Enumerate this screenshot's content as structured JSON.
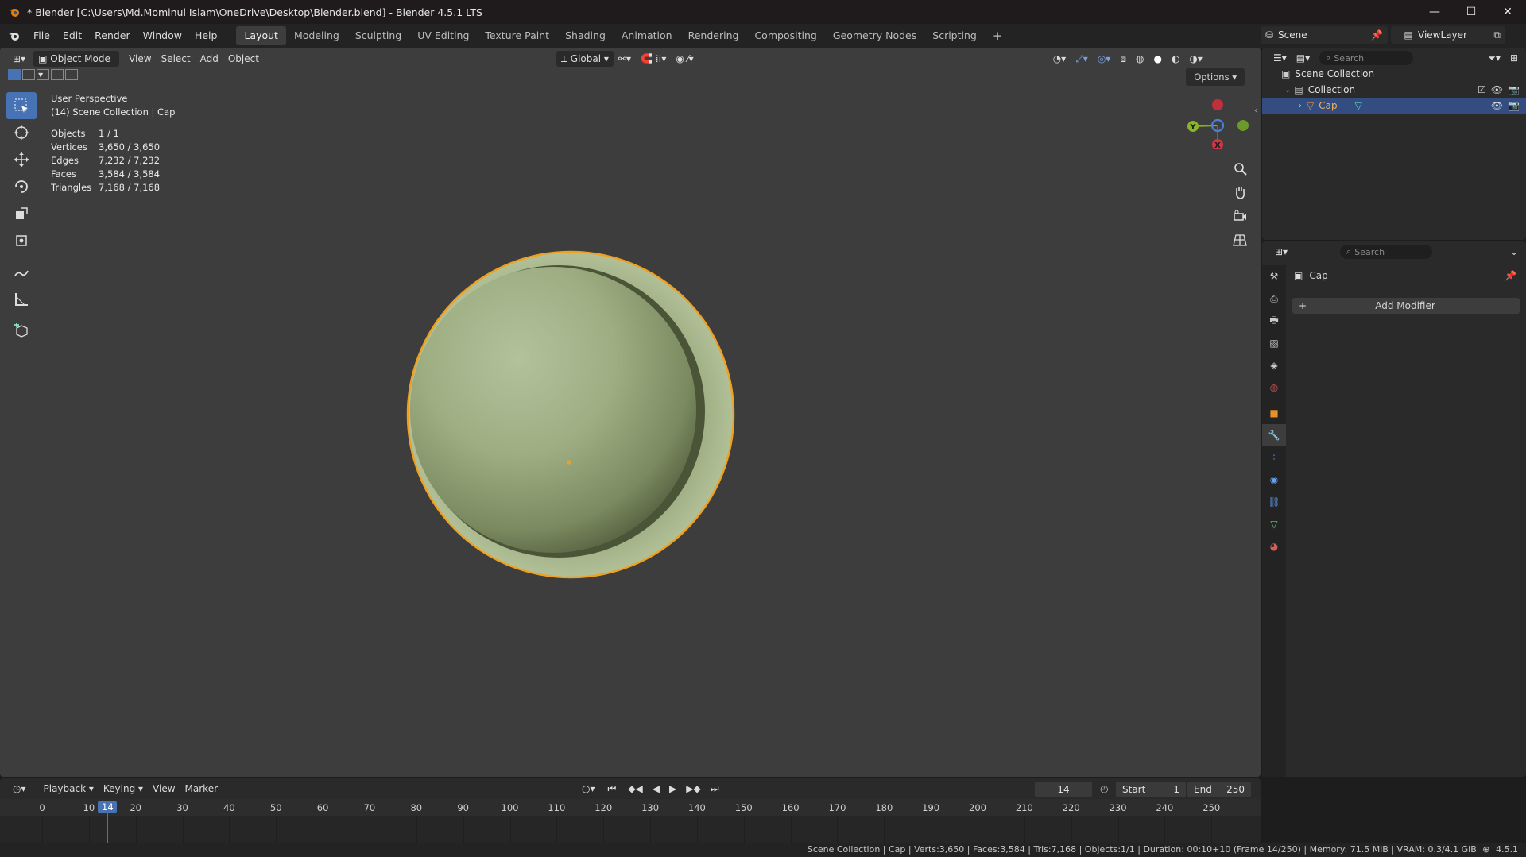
{
  "window": {
    "title": "* Blender [C:\\Users\\Md.Mominul Islam\\OneDrive\\Desktop\\Blender.blend] - Blender 4.5.1 LTS",
    "minimize": "—",
    "maximize": "☐",
    "close": "✕"
  },
  "menu": [
    "File",
    "Edit",
    "Render",
    "Window",
    "Help"
  ],
  "workspaces": [
    "Layout",
    "Modeling",
    "Sculpting",
    "UV Editing",
    "Texture Paint",
    "Shading",
    "Animation",
    "Rendering",
    "Compositing",
    "Geometry Nodes",
    "Scripting"
  ],
  "add_workspace": "+",
  "scene": {
    "name": "Scene",
    "view_layer": "ViewLayer"
  },
  "viewport": {
    "mode": "Object Mode",
    "header_menus": [
      "View",
      "Select",
      "Add",
      "Object"
    ],
    "transform_orientation": "Global",
    "options_label": "Options",
    "info_perspective": "User Perspective",
    "info_context": "(14) Scene Collection | Cap",
    "stats": [
      {
        "label": "Objects",
        "value": "1 / 1"
      },
      {
        "label": "Vertices",
        "value": "3,650 / 3,650"
      },
      {
        "label": "Edges",
        "value": "7,232 / 7,232"
      },
      {
        "label": "Faces",
        "value": "3,584 / 3,584"
      },
      {
        "label": "Triangles",
        "value": "7,168 / 7,168"
      }
    ],
    "gizmo": {
      "y": "Y",
      "x": "X"
    },
    "object_color": "#a6b48c",
    "selection_color": "#f0a020"
  },
  "outliner": {
    "search_placeholder": "Search",
    "root": "Scene Collection",
    "collection": "Collection",
    "object": "Cap"
  },
  "properties": {
    "search_placeholder": "Search",
    "object_name": "Cap",
    "add_modifier": "Add Modifier",
    "add_icon": "+"
  },
  "timeline": {
    "menus": [
      "Playback",
      "Keying",
      "View",
      "Marker"
    ],
    "current_frame": "14",
    "start_label": "Start",
    "start": "1",
    "end_label": "End",
    "end": "250",
    "ticks": [
      "0",
      "10",
      "20",
      "30",
      "40",
      "50",
      "60",
      "70",
      "80",
      "90",
      "100",
      "110",
      "120",
      "130",
      "140",
      "150",
      "160",
      "170",
      "180",
      "190",
      "200",
      "210",
      "220",
      "230",
      "240",
      "250"
    ],
    "playhead": "14"
  },
  "statusbar": {
    "text": "Scene Collection | Cap | Verts:3,650 | Faces:3,584 | Tris:7,168 | Objects:1/1 | Duration: 00:10+10 (Frame 14/250) | Memory: 71.5 MiB | VRAM: 0.3/4.1 GiB",
    "version": "4.5.1"
  }
}
